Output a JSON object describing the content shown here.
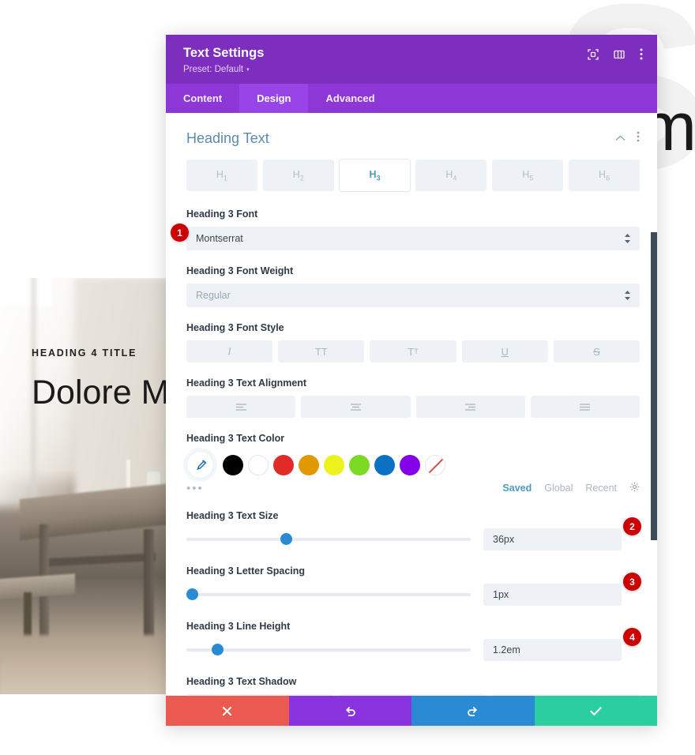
{
  "background": {
    "watermark_letter": "S",
    "hero_letter": "m",
    "eyebrow": "HEADING 4 TITLE",
    "headline": "Dolore Ma",
    "photo_alt": "rustic-dining-table-photo"
  },
  "modal": {
    "title": "Text Settings",
    "preset_label": "Preset: Default",
    "preset_caret": "▾",
    "header_icons": [
      "target-focus-icon",
      "panel-layout-icon",
      "kebab-menu-icon"
    ],
    "tabs": [
      {
        "label": "Content",
        "active": false
      },
      {
        "label": "Design",
        "active": true
      },
      {
        "label": "Advanced",
        "active": false
      }
    ],
    "section": {
      "title": "Heading Text",
      "collapse_icon": "chevron-up-icon",
      "menu_icon": "kebab-menu-icon"
    },
    "heading_levels": [
      {
        "label": "H",
        "sub": "1",
        "active": false
      },
      {
        "label": "H",
        "sub": "2",
        "active": false
      },
      {
        "label": "H",
        "sub": "3",
        "active": true
      },
      {
        "label": "H",
        "sub": "4",
        "active": false
      },
      {
        "label": "H",
        "sub": "5",
        "active": false
      },
      {
        "label": "H",
        "sub": "6",
        "active": false
      }
    ],
    "fields": {
      "font": {
        "label": "Heading 3 Font",
        "value": "Montserrat"
      },
      "font_weight": {
        "label": "Heading 3 Font Weight",
        "value": "Regular"
      },
      "font_style": {
        "label": "Heading 3 Font Style",
        "options": [
          {
            "name": "italic",
            "glyph": "I"
          },
          {
            "name": "uppercase",
            "glyph": "TT"
          },
          {
            "name": "small-caps",
            "glyph_large": "T",
            "glyph_small": "T"
          },
          {
            "name": "underline",
            "glyph": "U"
          },
          {
            "name": "strikethrough",
            "glyph": "S"
          }
        ]
      },
      "text_alignment": {
        "label": "Heading 3 Text Alignment",
        "options": [
          "align-left",
          "align-center",
          "align-right",
          "align-justify"
        ]
      },
      "text_color": {
        "label": "Heading 3 Text Color",
        "eyedropper_icon": "eyedropper-icon",
        "more_label": "•••",
        "swatches": [
          "#000000",
          "#ffffff",
          "#e02b27",
          "#e09900",
          "#edf21d",
          "#7cda24",
          "#0c71c3",
          "#8300e9",
          "transparent"
        ],
        "palette_tabs": [
          {
            "label": "Saved",
            "active": true
          },
          {
            "label": "Global",
            "active": false
          },
          {
            "label": "Recent",
            "active": false
          }
        ],
        "settings_icon": "gear-icon"
      },
      "text_size": {
        "label": "Heading 3 Text Size",
        "value": "36px",
        "slider_percent": 36
      },
      "letter_spacing": {
        "label": "Heading 3 Letter Spacing",
        "value": "1px",
        "slider_percent": 2
      },
      "line_height": {
        "label": "Heading 3 Line Height",
        "value": "1.2em",
        "slider_percent": 11
      },
      "text_shadow": {
        "label": "Heading 3 Text Shadow",
        "option_count": 3
      }
    },
    "action_bar": [
      {
        "name": "cancel-button",
        "icon": "✖",
        "color": "#ea5a51"
      },
      {
        "name": "undo-button",
        "icon": "↺",
        "color": "#8833dd"
      },
      {
        "name": "redo-button",
        "icon": "↻",
        "color": "#2a8bd4"
      },
      {
        "name": "save-button",
        "icon": "✔",
        "color": "#2bcea0"
      }
    ]
  },
  "annotations": [
    {
      "number": "1",
      "target": "font-select"
    },
    {
      "number": "2",
      "target": "text-size-value"
    },
    {
      "number": "3",
      "target": "letter-spacing-value"
    },
    {
      "number": "4",
      "target": "line-height-value"
    }
  ]
}
